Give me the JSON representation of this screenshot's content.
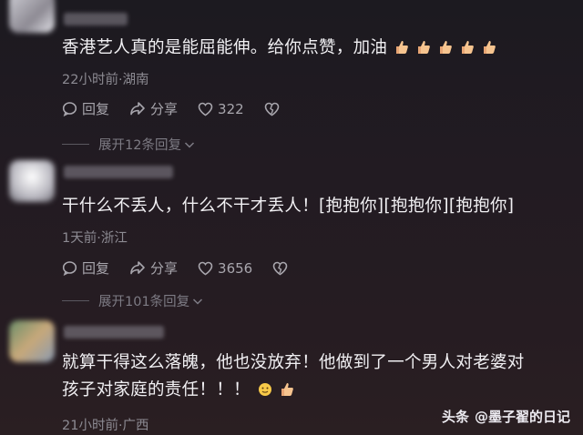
{
  "comments": [
    {
      "text": "香港艺人真的是能屈能伸。给你点赞，加油",
      "meta": "22小时前·湖南",
      "reply_label": "回复",
      "share_label": "分享",
      "likes": "322",
      "expand_label": "展开12条回复"
    },
    {
      "text": "干什么不丢人，什么不干才丢人！[抱抱你][抱抱你][抱抱你]",
      "meta": "1天前·浙江",
      "reply_label": "回复",
      "share_label": "分享",
      "likes": "3656",
      "expand_label": "展开101条回复"
    },
    {
      "text_line1": "就算干得这么落魄，他也没放弃！他做到了一个男人对老婆对",
      "text_line2": "孩子对家庭的责任！！！",
      "meta": "21小时前·广西"
    }
  ],
  "watermark": {
    "brand": "头条",
    "author": "@墨子翟的日记"
  },
  "icons": [
    "reply-icon",
    "share-icon",
    "like-heart-icon",
    "dislike-heart-icon",
    "chevron-down-icon",
    "thumbs-up-emoji",
    "hug-emoji"
  ],
  "colors": {
    "background": "#221b22",
    "text": "#f1f0f3",
    "meta": "#8c8a92"
  }
}
